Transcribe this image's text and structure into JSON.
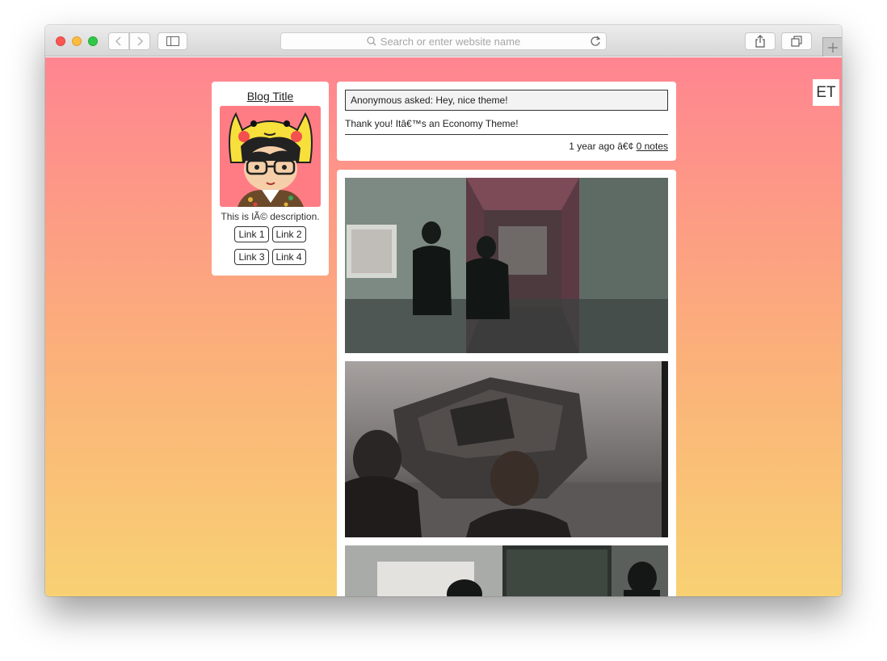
{
  "browser": {
    "url_placeholder": "Search or enter website name"
  },
  "sidebar": {
    "title": "Blog Title",
    "description": "This is lÃ© description.",
    "links": [
      "Link 1",
      "Link 2",
      "Link 3",
      "Link 4"
    ]
  },
  "corner_badge": "ET",
  "ask_post": {
    "question": "Anonymous asked: Hey, nice theme!",
    "answer": "Thank you! Itâ€™s an Economy Theme!",
    "timestamp": "1 year ago â€¢",
    "notes": "0 notes"
  },
  "colors": {
    "gradient_top": "#ff8591",
    "gradient_bottom": "#f8d173",
    "card_background": "#ffffff"
  }
}
